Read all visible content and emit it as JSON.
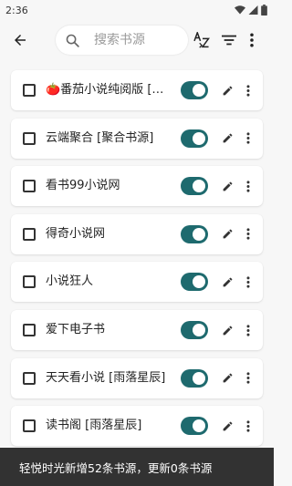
{
  "status_bar": {
    "time": "2:36"
  },
  "toolbar": {
    "search_placeholder": "搜索书源",
    "icons": [
      "back-icon",
      "search-icon",
      "sort-az-icon",
      "filter-icon",
      "more-vert-icon"
    ]
  },
  "sources": [
    {
      "name": "🍅番茄小说纯阅版 [🍅番茄小说]",
      "enabled": true
    },
    {
      "name": "云端聚合 [聚合书源]",
      "enabled": true
    },
    {
      "name": "看书99小说网",
      "enabled": true
    },
    {
      "name": "得奇小说网",
      "enabled": true
    },
    {
      "name": "小说狂人",
      "enabled": true
    },
    {
      "name": "爱下电子书",
      "enabled": true
    },
    {
      "name": "天天看小说 [雨落星辰]",
      "enabled": true
    },
    {
      "name": "读书阁 [雨落星辰]",
      "enabled": true
    }
  ],
  "snackbar": {
    "message": "轻悦时光新增52条书源，更新0条书源"
  },
  "colors": {
    "accent": "#1e6a6e",
    "snackbar_bg": "#323232",
    "background": "#f7f7f7"
  }
}
